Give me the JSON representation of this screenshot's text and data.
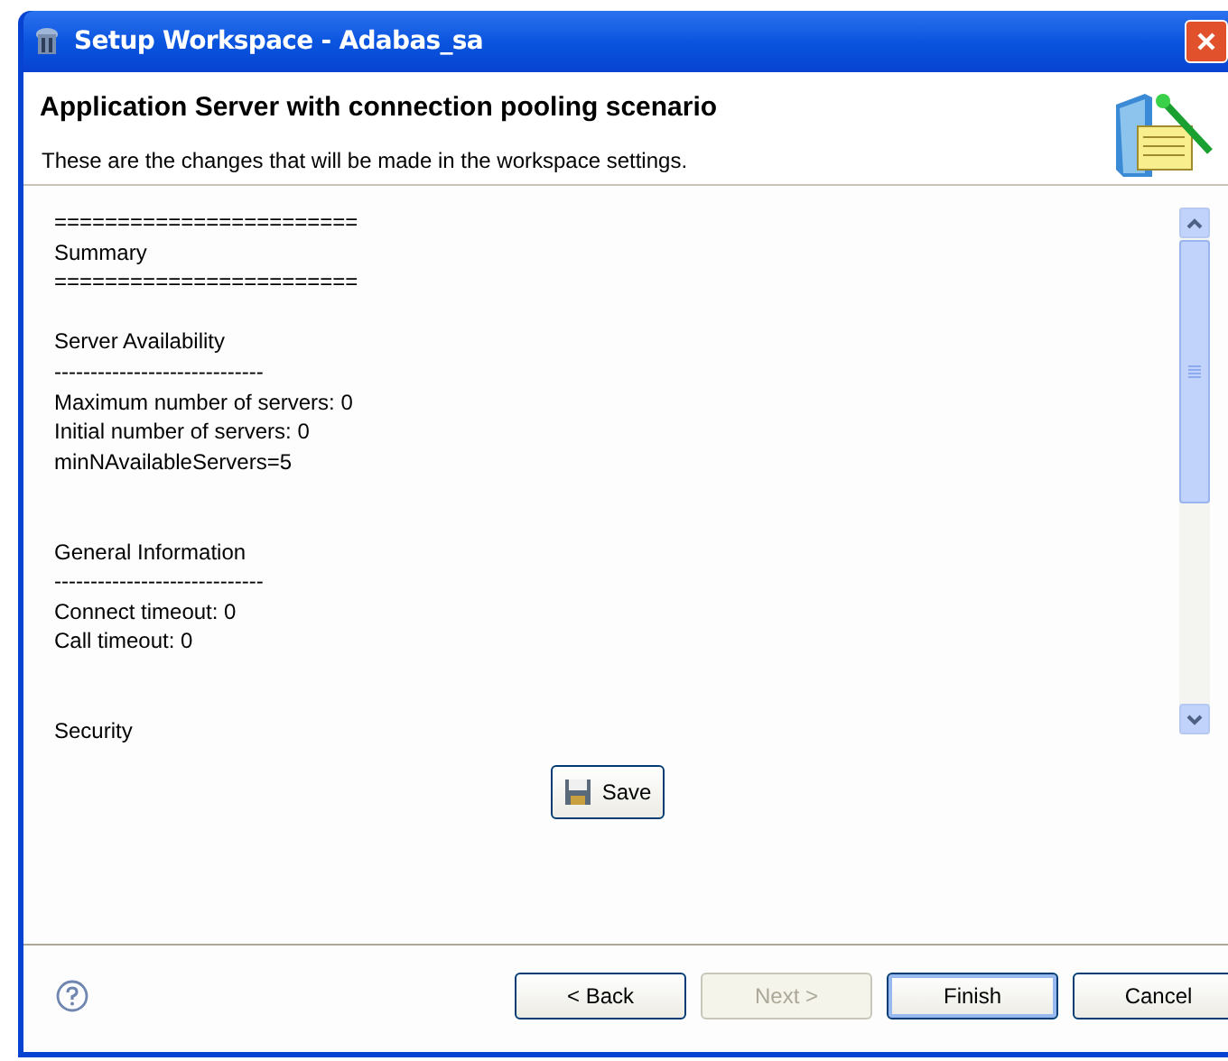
{
  "window": {
    "title": "Setup Workspace - Adabas_sa"
  },
  "header": {
    "title": "Application Server with connection pooling scenario",
    "description": "These are the changes that will be made in the workspace settings."
  },
  "summary_blocks": [
    [
      "========================",
      "Summary",
      "========================"
    ],
    [
      "Server Availability",
      "-----------------------------",
      "Maximum number of servers: 0",
      "Initial number of servers: 0",
      "minNAvailableServers=5"
    ],
    [
      "General Information",
      "-----------------------------",
      "Connect timeout: 0",
      "Call timeout: 0"
    ],
    [
      "Security"
    ]
  ],
  "save_button": {
    "label": "Save"
  },
  "buttons": [
    {
      "label": "< Back",
      "disabled": false,
      "default": false
    },
    {
      "label": "Next >",
      "disabled": true,
      "default": false
    },
    {
      "label": "Finish",
      "disabled": false,
      "default": true
    },
    {
      "label": "Cancel",
      "disabled": false,
      "default": false
    }
  ]
}
